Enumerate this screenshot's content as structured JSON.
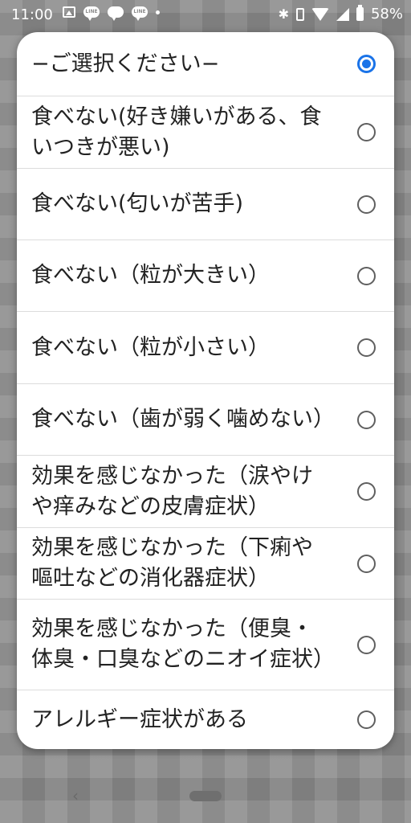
{
  "status_bar": {
    "time": "11:00",
    "left_icons": [
      "image-icon",
      "line-icon",
      "chat-bubble-icon",
      "line-icon",
      "dot-icon"
    ],
    "line_label": "LINE",
    "right_icons": [
      "bluetooth-icon",
      "vibrate-icon",
      "wifi-icon",
      "signal-icon",
      "battery-icon"
    ],
    "bluetooth_glyph": "✱",
    "battery_percent": "58%"
  },
  "dialog": {
    "selected_index": 0,
    "accent_color": "#1a73e8",
    "options": [
      {
        "label": "−ご選択ください−",
        "selected": true
      },
      {
        "label": "食べない(好き嫌いがある、食いつきが悪い)",
        "selected": false
      },
      {
        "label": "食べない(匂いが苦手)",
        "selected": false
      },
      {
        "label": "食べない（粒が大きい）",
        "selected": false
      },
      {
        "label": "食べない（粒が小さい）",
        "selected": false
      },
      {
        "label": "食べない（歯が弱く噛めない）",
        "selected": false
      },
      {
        "label": "効果を感じなかった（涙やけや痒みなどの皮膚症状）",
        "selected": false
      },
      {
        "label": "効果を感じなかった（下痢や嘔吐などの消化器症状）",
        "selected": false
      },
      {
        "label": "効果を感じなかった（便臭・体臭・口臭などのニオイ症状）",
        "selected": false
      },
      {
        "label": "アレルギー症状がある",
        "selected": false
      }
    ]
  },
  "nav_bar": {
    "back_glyph": "‹"
  }
}
